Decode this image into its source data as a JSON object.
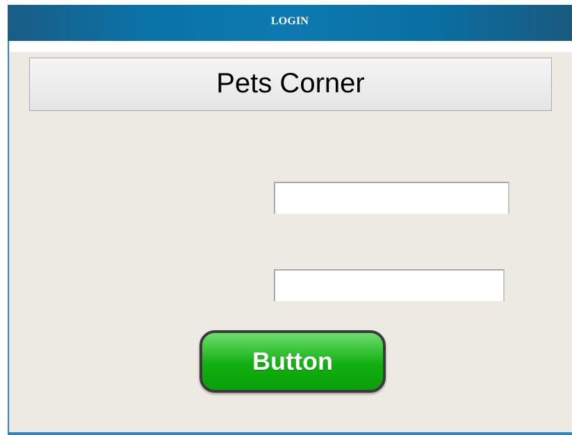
{
  "window": {
    "title": "LOGIN"
  },
  "header": {
    "app_name": "Pets Corner"
  },
  "form": {
    "field_1": {
      "value": "",
      "placeholder": ""
    },
    "field_2": {
      "value": "",
      "placeholder": ""
    },
    "submit_label": "Button"
  },
  "colors": {
    "title_bar": "#0a73a8",
    "content_background": "#ede9e3",
    "button_green": "#11b011"
  }
}
